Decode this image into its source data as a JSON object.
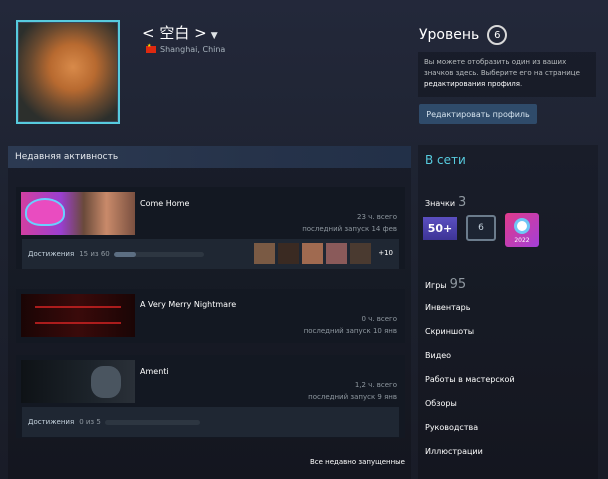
{
  "profile": {
    "persona_name": "< 空白 >",
    "location": "Shanghai, China"
  },
  "level": {
    "label": "Уровень",
    "value": "6",
    "info_text": "Вы можете отобразить один из ваших значков здесь. Выберите его на странице",
    "info_link": "редактирования профиля",
    "info_end": ".",
    "edit_button": "Редактировать профиль"
  },
  "activity": {
    "header": "Недавняя активность",
    "games": [
      {
        "name": "Come Home",
        "hours": "23 ч. всего",
        "last_played": "последний запуск 14 фев",
        "achievements_label": "Достижения",
        "achievements_count": "15 из 60",
        "progress": 0.25,
        "more": "+10"
      },
      {
        "name": "A Very Merry Nightmare",
        "hours": "0 ч. всего",
        "last_played": "последний запуск 10 янв"
      },
      {
        "name": "Amenti",
        "hours": "1,2 ч. всего",
        "last_played": "последний запуск 9 янв",
        "achievements_label": "Достижения",
        "achievements_count": "0 из 5",
        "progress": 0.0
      }
    ],
    "all_recent": "Все недавно запущенные"
  },
  "sidebar": {
    "status": "В сети",
    "badges_label": "Значки",
    "badges_count": "3",
    "badge_50": "50+",
    "badge_6": "6",
    "badge_2022_year": "2022",
    "games_label": "Игры",
    "games_count": "95",
    "links": [
      "Инвентарь",
      "Скриншоты",
      "Видео",
      "Работы в мастерской",
      "Обзоры",
      "Руководства",
      "Иллюстрации"
    ]
  },
  "colors": {
    "accent_online": "#57cbde",
    "button_bg": "#2f4b6a"
  }
}
